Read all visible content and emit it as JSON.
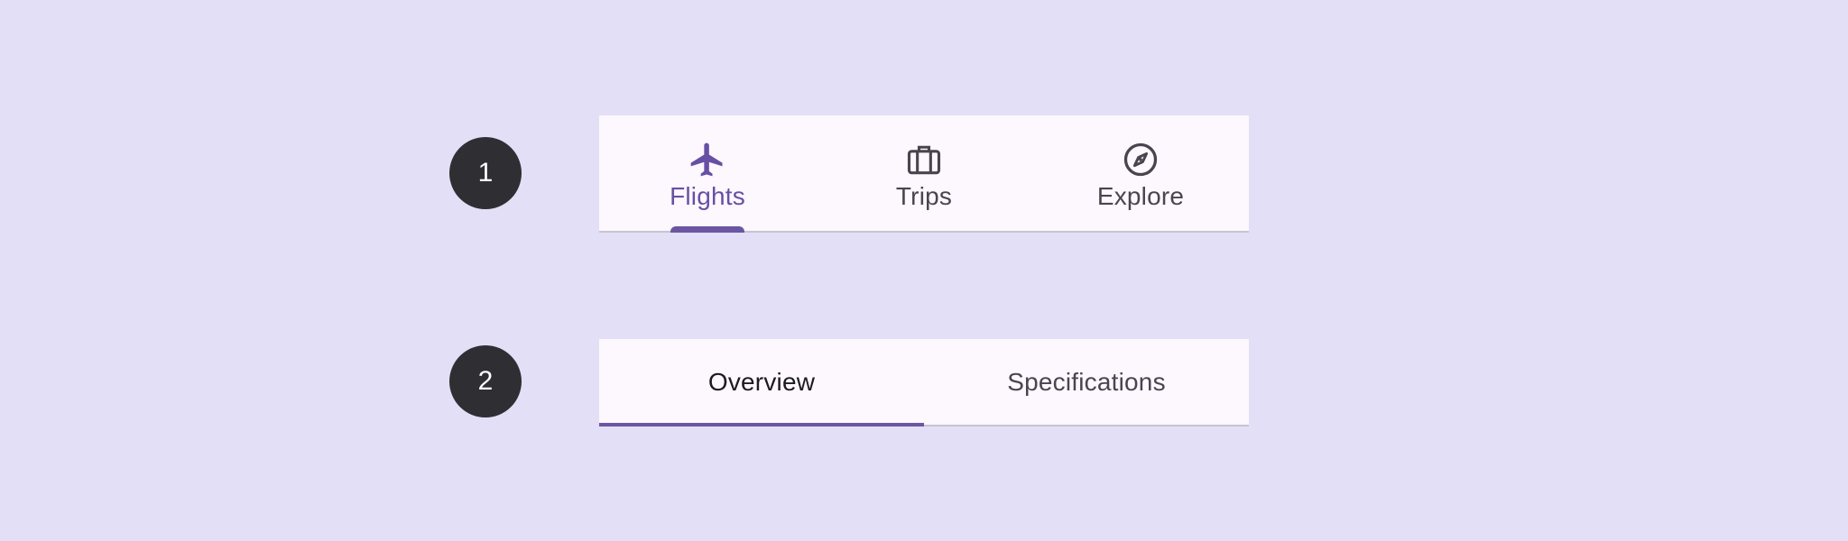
{
  "badges": {
    "first": "1",
    "second": "2"
  },
  "primary_tabs": {
    "active_index": 0,
    "items": [
      {
        "label": "Flights",
        "icon": "airplane-icon",
        "active": true
      },
      {
        "label": "Trips",
        "icon": "luggage-icon",
        "active": false
      },
      {
        "label": "Explore",
        "icon": "compass-icon",
        "active": false
      }
    ]
  },
  "secondary_tabs": {
    "active_index": 0,
    "items": [
      {
        "label": "Overview",
        "active": true
      },
      {
        "label": "Specifications",
        "active": false
      }
    ]
  },
  "colors": {
    "background": "#E2DFF6",
    "surface": "#FDF7FE",
    "accent": "#6750A4",
    "on_surface_variant": "#49454F",
    "badge": "#2F2E33"
  }
}
